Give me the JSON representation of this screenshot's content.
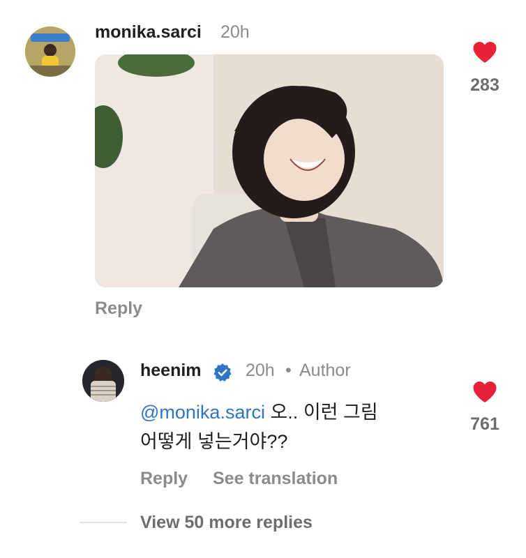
{
  "comment": {
    "username": "monika.sarci",
    "time": "20h",
    "likes": "283",
    "reply_label": "Reply"
  },
  "reply": {
    "username": "heenim",
    "time": "20h",
    "separator": "•",
    "author_label": "Author",
    "mention": "@monika.sarci",
    "text_line1": " 오.. 이런 그림",
    "text_line2": "어떻게 넣는거야??",
    "likes": "761",
    "reply_label": "Reply",
    "see_translation_label": "See translation"
  },
  "view_more": "View 50 more replies",
  "colors": {
    "heart": "#e8213a",
    "verified": "#2f75c2",
    "mention": "#2f75c2"
  },
  "icons": {
    "like": "heart-icon",
    "verified": "verified-badge-icon"
  }
}
